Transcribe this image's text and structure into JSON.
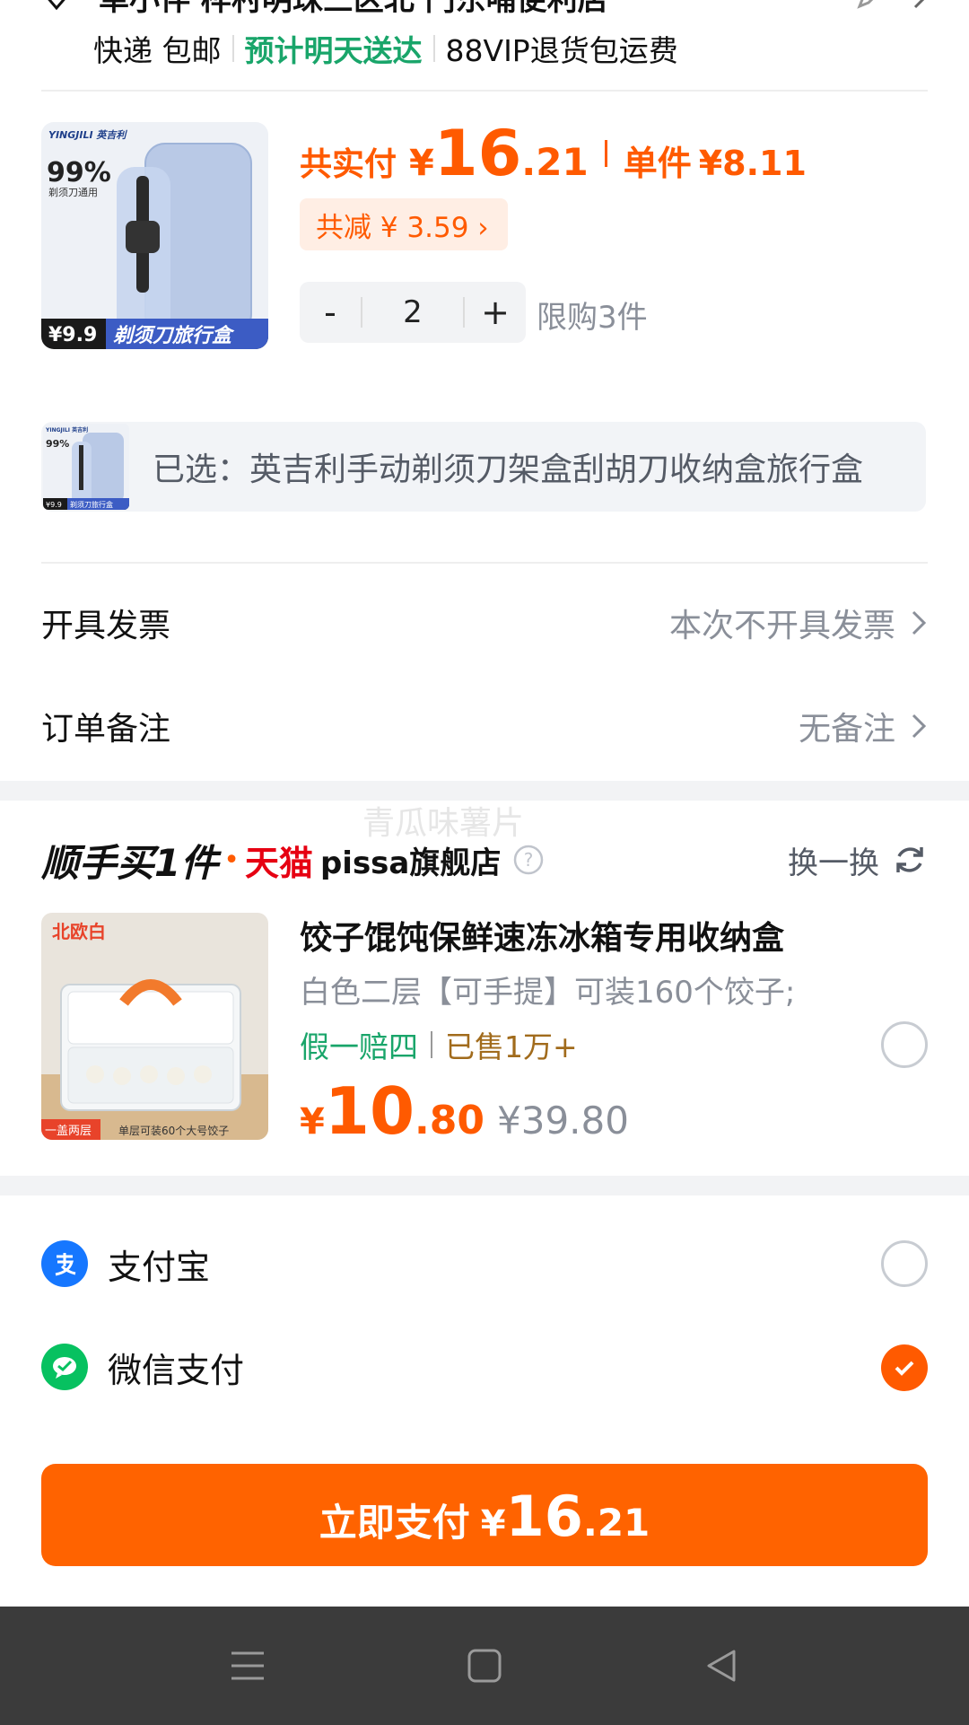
{
  "address": {
    "text": "单小伴 桦村明珠三区北 门东哺便利店"
  },
  "delivery": {
    "express": "快递 包邮",
    "eta": "预计明天送达",
    "vip": "88VIP退货包运费"
  },
  "product": {
    "img_brand": "YINGJILI 英吉利",
    "img_pct": "99%",
    "img_sub": "剃须刀通用",
    "img_price": "¥9.9",
    "img_caption": "剃须刀旅行盒",
    "total_label": "共实付",
    "currency": "¥",
    "total_int": "16",
    "total_dec": ".21",
    "unit_label": "单件",
    "unit_price": "¥8.11",
    "discount": "共减 ¥ 3.59 ›",
    "minus": "-",
    "quantity": "2",
    "plus": "+",
    "limit": "限购3件"
  },
  "selected": {
    "text": "已选：英吉利手动剃须刀架盒刮胡刀收纳盒旅行盒"
  },
  "invoice": {
    "label": "开具发票",
    "value": "本次不开具发票"
  },
  "remark": {
    "label": "订单备注",
    "value": "无备注"
  },
  "shunshou": {
    "brand": "顺手买1件",
    "dot": "•",
    "tmall": "天猫",
    "store": "pissa旗舰店",
    "swap": "换一换",
    "watermark": "青瓜味薯片",
    "img_label": "北欧白",
    "img_bottom_tag": "一盖两层",
    "img_bottom_text": "单层可装60个大号饺子",
    "title": "饺子馄饨保鲜速冻冰箱专用收纳盒",
    "sku": "白色二层【可手提】可装160个饺子;",
    "tag1": "假一赔四",
    "tag2": "已售1万+",
    "currency": "¥",
    "price_int": "10",
    "price_dec": ".80",
    "orig_price": "¥39.80"
  },
  "payment": {
    "alipay_label": "支付宝",
    "wechat_label": "微信支付",
    "selected": "wechat"
  },
  "pay_button": {
    "label": "立即支付",
    "currency": "¥",
    "int": "16",
    "dec": ".21"
  },
  "colors": {
    "accent": "#ff5a00",
    "button": "#ff6300",
    "green": "#19a56a",
    "alipay": "#1677ff",
    "wechat": "#07c160"
  }
}
